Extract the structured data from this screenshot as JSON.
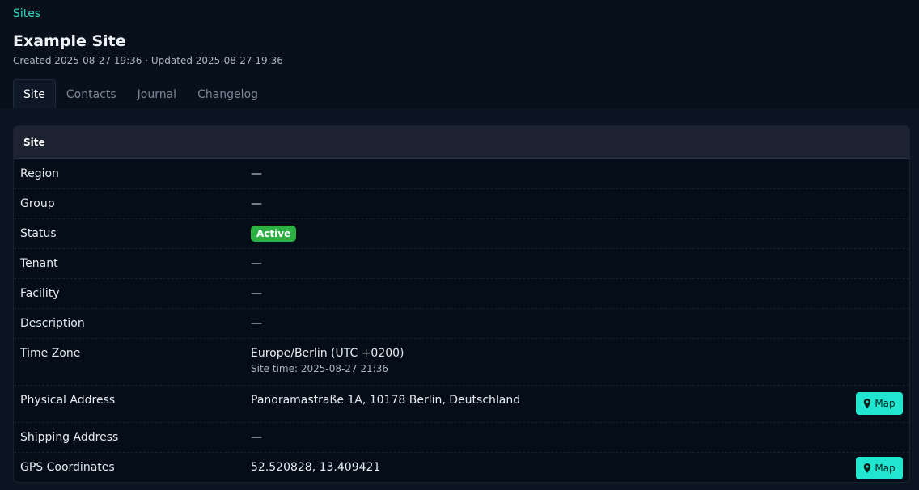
{
  "breadcrumb": "Sites",
  "title": "Example Site",
  "meta": "Created 2025-08-27 19:36 · Updated 2025-08-27 19:36",
  "tabs": [
    {
      "label": "Site",
      "active": true
    },
    {
      "label": "Contacts",
      "active": false
    },
    {
      "label": "Journal",
      "active": false
    },
    {
      "label": "Changelog",
      "active": false
    }
  ],
  "card": {
    "title": "Site",
    "rows": {
      "region": {
        "label": "Region",
        "value": "—"
      },
      "group": {
        "label": "Group",
        "value": "—"
      },
      "status": {
        "label": "Status",
        "value": "Active"
      },
      "tenant": {
        "label": "Tenant",
        "value": "—"
      },
      "facility": {
        "label": "Facility",
        "value": "—"
      },
      "description": {
        "label": "Description",
        "value": "—"
      },
      "time_zone": {
        "label": "Time Zone",
        "value": "Europe/Berlin (UTC +0200)",
        "site_time": "Site time: 2025-08-27 21:36"
      },
      "physical_address": {
        "label": "Physical Address",
        "value": "Panoramastraße 1A, 10178 Berlin, Deutschland",
        "button": "Map"
      },
      "shipping_address": {
        "label": "Shipping Address",
        "value": "—"
      },
      "gps": {
        "label": "GPS Coordinates",
        "value": "52.520828, 13.409421",
        "button": "Map"
      }
    }
  },
  "colors": {
    "accent": "#2fd9c0",
    "status_active": "#2eb144",
    "map_button": "#22e5d0"
  },
  "icons": {
    "map_button": "map-pin-icon"
  }
}
